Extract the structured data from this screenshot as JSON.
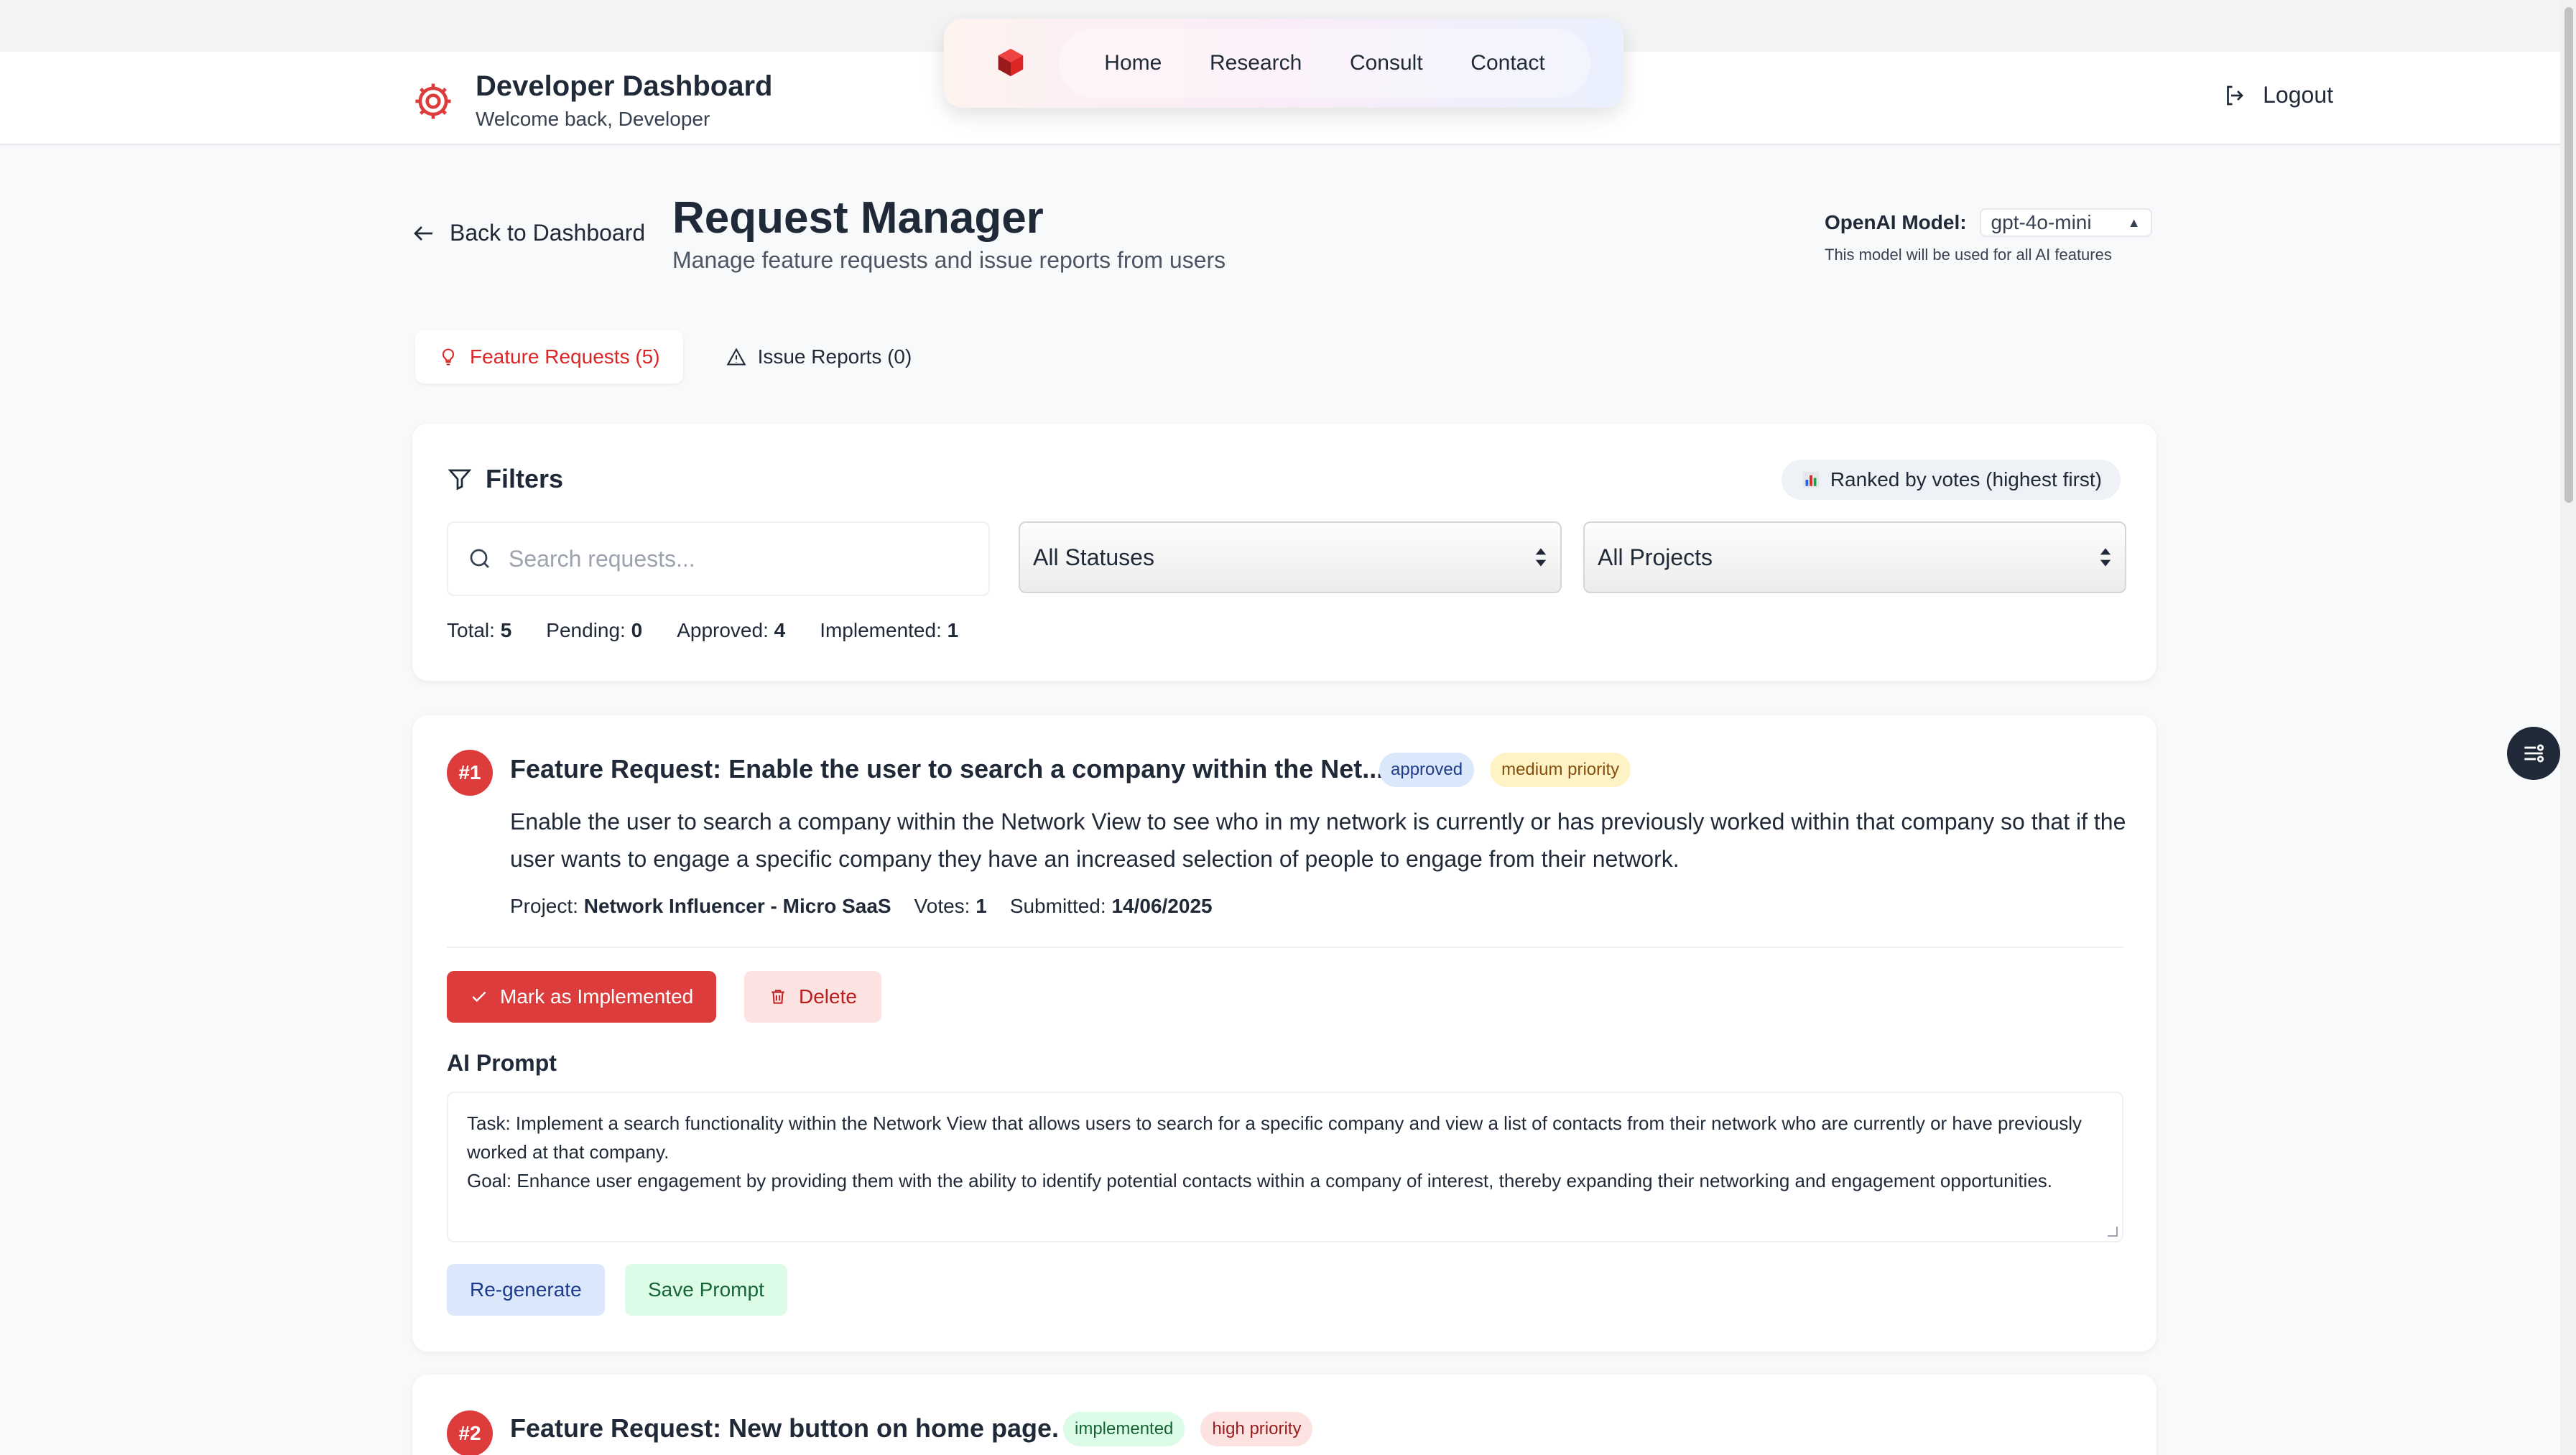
{
  "header": {
    "title": "Developer Dashboard",
    "subtitle": "Welcome back, Developer",
    "logout_label": "Logout"
  },
  "nav": {
    "links": [
      "Home",
      "Research",
      "Consult",
      "Contact"
    ]
  },
  "page": {
    "back_label": "Back to Dashboard",
    "title": "Request Manager",
    "subtitle": "Manage feature requests and issue reports from users"
  },
  "model": {
    "label": "OpenAI Model:",
    "selected": "gpt-4o-mini",
    "note": "This model will be used for all AI features"
  },
  "tabs": [
    {
      "label": "Feature Requests (5)",
      "icon": "lightbulb-icon",
      "active": true
    },
    {
      "label": "Issue Reports (0)",
      "icon": "warning-triangle-icon",
      "active": false
    }
  ],
  "filters": {
    "title": "Filters",
    "ranked_label": "Ranked by votes (highest first)",
    "search_placeholder": "Search requests...",
    "status_selected": "All Statuses",
    "project_selected": "All Projects",
    "stats": [
      {
        "label": "Total:",
        "value": "5"
      },
      {
        "label": "Pending:",
        "value": "0"
      },
      {
        "label": "Approved:",
        "value": "4"
      },
      {
        "label": "Implemented:",
        "value": "1"
      }
    ]
  },
  "requests": [
    {
      "rank": "#1",
      "title": "Feature Request: Enable the user to search a company within the Net...",
      "status": "approved",
      "priority": "medium priority",
      "description": "Enable the user to search a company within the Network View to see who in my network is currently or has previously worked within that company so that if the user wants to engage a specific company they have an increased selection of people to engage from their network.",
      "project_label": "Project:",
      "project": "Network Influencer - Micro SaaS",
      "votes_label": "Votes:",
      "votes": "1",
      "submitted_label": "Submitted:",
      "submitted": "14/06/2025",
      "mark_label": "Mark as Implemented",
      "delete_label": "Delete",
      "ai_label": "AI Prompt",
      "ai_prompt": "Task: Implement a search functionality within the Network View that allows users to search for a specific company and view a list of contacts from their network who are currently or have previously worked at that company.\nGoal: Enhance user engagement by providing them with the ability to identify potential contacts within a company of interest, thereby expanding their networking and engagement opportunities.",
      "regen_label": "Re-generate",
      "save_label": "Save Prompt"
    },
    {
      "rank": "#2",
      "title": "Feature Request: New button on home page.",
      "status": "implemented",
      "priority": "high priority"
    }
  ],
  "colors": {
    "accent_red": "#dc3c3c",
    "background": "#f8f9fb"
  }
}
